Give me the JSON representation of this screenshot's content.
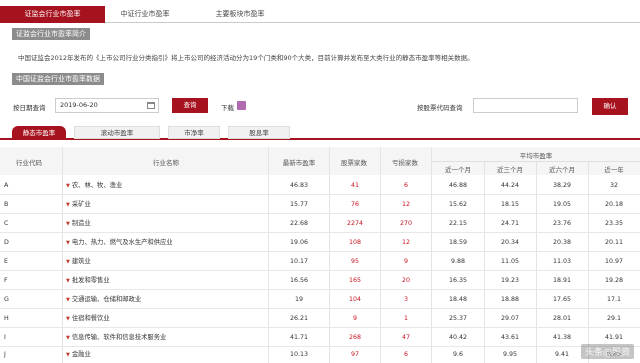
{
  "top_tabs": [
    "证监会行业市盈率",
    "中证行业市盈率",
    "主要板块市盈率"
  ],
  "intro_button": "证监会行业市盈率简介",
  "intro_text": "中国证监会2012年发布的《上市公司行业分类指引》将上市公司的经济活动分为19个门类和90个大类，目前计算并发布至大类行业的静态市盈率等相关数据。",
  "data_button": "中国证监会行业市盈率数据",
  "query": {
    "date_label": "按日期查询",
    "date_value": "2019-06-20",
    "query_button": "查询",
    "download_label": "下载",
    "code_label": "按股票代码查询",
    "confirm_button": "确认"
  },
  "sub_tabs": [
    "静态市盈率",
    "滚动市盈率",
    "市净率",
    "股息率"
  ],
  "table": {
    "headers": {
      "code": "行业代码",
      "name": "行业名称",
      "latest_pe": "最新市盈率",
      "stock_count": "股票家数",
      "loss_count": "亏损家数",
      "avg_pe": "平均市盈率",
      "m1": "近一个月",
      "m3": "近三个月",
      "m6": "近六个月",
      "y1": "近一年"
    },
    "rows": [
      {
        "code": "A",
        "name": "农、林、牧、渔业",
        "latest": "46.83",
        "stocks": "41",
        "loss": "6",
        "m1": "46.88",
        "m3": "44.24",
        "m6": "38.29",
        "y1": "32"
      },
      {
        "code": "B",
        "name": "采矿业",
        "latest": "15.77",
        "stocks": "76",
        "loss": "12",
        "m1": "15.62",
        "m3": "18.15",
        "m6": "19.05",
        "y1": "20.18"
      },
      {
        "code": "C",
        "name": "制造业",
        "latest": "22.68",
        "stocks": "2274",
        "loss": "270",
        "m1": "22.15",
        "m3": "24.71",
        "m6": "23.76",
        "y1": "23.35"
      },
      {
        "code": "D",
        "name": "电力、热力、燃气及水生产和供应业",
        "latest": "19.06",
        "stocks": "108",
        "loss": "12",
        "m1": "18.59",
        "m3": "20.34",
        "m6": "20.38",
        "y1": "20.11"
      },
      {
        "code": "E",
        "name": "建筑业",
        "latest": "10.17",
        "stocks": "95",
        "loss": "9",
        "m1": "9.88",
        "m3": "11.05",
        "m6": "11.03",
        "y1": "10.97"
      },
      {
        "code": "F",
        "name": "批发和零售业",
        "latest": "16.56",
        "stocks": "165",
        "loss": "20",
        "m1": "16.35",
        "m3": "19.23",
        "m6": "18.91",
        "y1": "19.28"
      },
      {
        "code": "G",
        "name": "交通运输、仓储和邮政业",
        "latest": "19",
        "stocks": "104",
        "loss": "3",
        "m1": "18.48",
        "m3": "18.88",
        "m6": "17.65",
        "y1": "17.1"
      },
      {
        "code": "H",
        "name": "住宿和餐饮业",
        "latest": "26.21",
        "stocks": "9",
        "loss": "1",
        "m1": "25.37",
        "m3": "29.07",
        "m6": "28.01",
        "y1": "29.1"
      },
      {
        "code": "I",
        "name": "信息传输、软件和信息技术服务业",
        "latest": "41.71",
        "stocks": "268",
        "loss": "47",
        "m1": "40.42",
        "m3": "43.61",
        "m6": "41.38",
        "y1": "41.91"
      },
      {
        "code": "J",
        "name": "金融业",
        "latest": "10.13",
        "stocks": "97",
        "loss": "6",
        "m1": "9.6",
        "m3": "9.95",
        "m6": "9.41",
        "y1": "8.85"
      }
    ]
  },
  "watermark": "头条@股资"
}
